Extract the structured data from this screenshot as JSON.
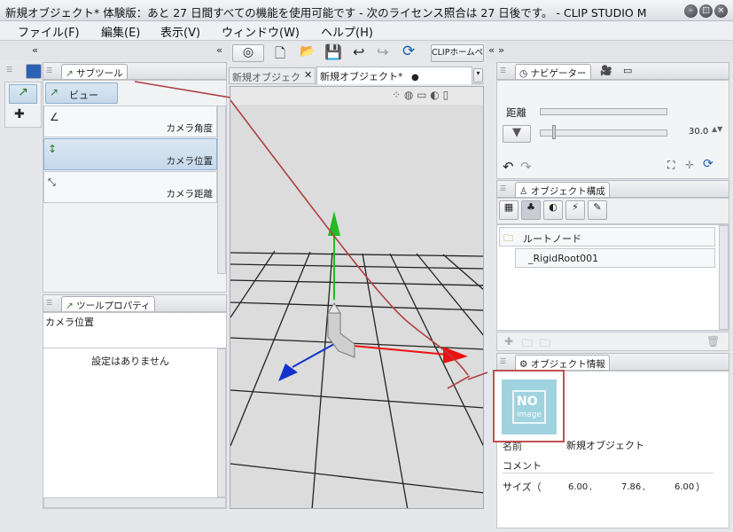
{
  "window": {
    "title": "新規オブジェクト* 体験版：あと 27 日間すべての機能を使用可能です - 次のライセンス照合は 27 日後です。 - CLIP STUDIO M"
  },
  "menubar": [
    "ファイル(F)",
    "編集(E)",
    "表示(V)",
    "ウィンドウ(W)",
    "ヘルプ(H)"
  ],
  "toolbar": {
    "web_button": "CLIPホームペ"
  },
  "document_tabs": [
    {
      "label": "新規オブジェク"
    },
    {
      "label": "新規オブジェクト*"
    }
  ],
  "subtool_panel": {
    "tab": "サブツール",
    "group_button": "ビュー",
    "items": [
      {
        "label": "カメラ角度"
      },
      {
        "label": "カメラ位置"
      },
      {
        "label": "カメラ距離"
      }
    ]
  },
  "tool_property": {
    "tab": "ツールプロパティ",
    "current": "カメラ位置",
    "message": "設定はありません"
  },
  "navigator": {
    "tab": "ナビゲーター",
    "distance_label": "距離",
    "zoom_value": "30.0"
  },
  "object_structure": {
    "tab": "オブジェクト構成",
    "nodes": [
      {
        "label": "ルートノード"
      },
      {
        "label": "_RigidRoot001"
      }
    ]
  },
  "object_info": {
    "tab": "オブジェクト情報",
    "no_image_line1": "NO",
    "no_image_line2": "image",
    "name_label": "名前",
    "name_value": "新規オブジェクト",
    "comment_label": "コメント",
    "size_label": "サイズ（",
    "size_x": "6.00",
    "size_y": "7.86",
    "size_z": "6.00",
    "size_close": "）"
  },
  "colors": {
    "arrow_y": "#22bb22",
    "arrow_x": "#ee1111",
    "arrow_z": "#1133cc",
    "annotation": "#b04040",
    "highlight_box": "#c05050",
    "no_image_bg": "#9fd3df"
  }
}
